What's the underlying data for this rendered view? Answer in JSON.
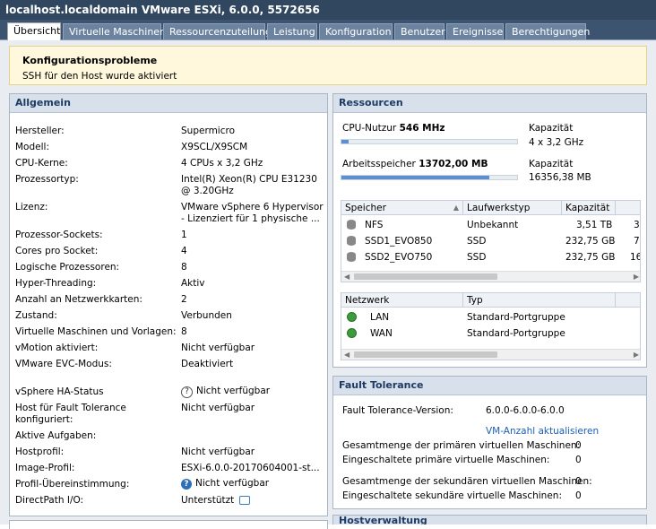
{
  "window": {
    "title": "localhost.localdomain VMware ESXi, 6.0.0, 5572656"
  },
  "tabs": [
    "Übersicht",
    "Virtuelle Maschinen",
    "Ressourcenzuteilung",
    "Leistung",
    "Konfiguration",
    "Benutzer",
    "Ereignisse",
    "Berechtigungen"
  ],
  "warning": {
    "title": "Konfigurationsprobleme",
    "message": "SSH für den Host wurde aktiviert"
  },
  "general": {
    "header": "Allgemein",
    "rows": [
      {
        "label": "Hersteller:",
        "value": "Supermicro"
      },
      {
        "label": "Modell:",
        "value": "X9SCL/X9SCM"
      },
      {
        "label": "CPU-Kerne:",
        "value": "4 CPUs x 3,2 GHz"
      },
      {
        "label": "Prozessortyp:",
        "value": "Intel(R) Xeon(R) CPU E31230",
        "value2": "@ 3.20GHz"
      },
      {
        "label": "Lizenz:",
        "value": "VMware vSphere 6 Hypervisor",
        "value2": "- Lizenziert für 1 physische ..."
      },
      {
        "label": "Prozessor-Sockets:",
        "value": "1"
      },
      {
        "label": "Cores pro Socket:",
        "value": "4"
      },
      {
        "label": "Logische Prozessoren:",
        "value": "8"
      },
      {
        "label": "Hyper-Threading:",
        "value": "Aktiv"
      },
      {
        "label": "Anzahl an Netzwerkkarten:",
        "value": "2"
      },
      {
        "label": "Zustand:",
        "value": "Verbunden"
      },
      {
        "label": "Virtuelle Maschinen und Vorlagen:",
        "value": "8"
      },
      {
        "label": "vMotion aktiviert:",
        "value": "Nicht verfügbar"
      },
      {
        "label": "VMware EVC-Modus:",
        "value": "Deaktiviert"
      },
      {
        "label": "vSphere HA-Status",
        "value": "Nicht verfügbar"
      },
      {
        "label": "Host für Fault Tolerance",
        "label2": "konfiguriert:",
        "value": "Nicht verfügbar"
      },
      {
        "label": "Aktive Aufgaben:",
        "value": ""
      },
      {
        "label": "Hostprofil:",
        "value": "Nicht verfügbar"
      },
      {
        "label": "Image-Profil:",
        "value": "ESXi-6.0.0-20170604001-st..."
      },
      {
        "label": "Profil-Übereinstimmung:",
        "value": "Nicht verfügbar"
      },
      {
        "label": "DirectPath I/O:",
        "value": "Unterstützt"
      }
    ]
  },
  "resources": {
    "header": "Ressourcen",
    "cpu": {
      "label": "CPU-Nutzur",
      "value": "546 MHz",
      "cap_label": "Kapazität",
      "cap_value": "4 x 3,2 GHz",
      "fill": 0.04
    },
    "mem": {
      "label": "Arbeitsspeicher",
      "value": "13702,00 MB",
      "cap_label": "Kapazität",
      "cap_value": "16356,38 MB",
      "fill": 0.84
    },
    "storage": {
      "headers": [
        "Speicher",
        "Laufwerkstyp",
        "Kapazität"
      ],
      "rows": [
        {
          "name": "NFS",
          "type": "Unbekannt",
          "cap": "3,51 TB",
          "extra": "3"
        },
        {
          "name": "SSD1_EVO850",
          "type": "SSD",
          "cap": "232,75 GB",
          "extra": "7"
        },
        {
          "name": "SSD2_EVO750",
          "type": "SSD",
          "cap": "232,75 GB",
          "extra": "16"
        }
      ]
    },
    "network": {
      "headers": [
        "Netzwerk",
        "Typ"
      ],
      "rows": [
        {
          "name": "LAN",
          "type": "Standard-Portgruppe"
        },
        {
          "name": "WAN",
          "type": "Standard-Portgruppe"
        }
      ]
    }
  },
  "fault_tolerance": {
    "header": "Fault Tolerance",
    "version_label": "Fault Tolerance-Version:",
    "version_value": "6.0.0-6.0.0-6.0.0",
    "refresh_link": "VM-Anzahl aktualisieren",
    "rows": [
      {
        "label": "Gesamtmenge der primären virtuellen Maschinen:",
        "value": "0"
      },
      {
        "label": "Eingeschaltete primäre virtuelle Maschinen:",
        "value": "0"
      },
      {
        "label": "Gesamtmenge der sekundären virtuellen Maschinen:",
        "value": "0"
      },
      {
        "label": "Eingeschaltete sekundäre virtuelle Maschinen:",
        "value": "0"
      }
    ]
  },
  "host_mgmt": {
    "header": "Hostverwaltung"
  },
  "colors": {
    "title_bg": "#31465f",
    "header_text": "#1e3b62",
    "warning_bg": "#fff8dc",
    "usage_bar": "#5b8fd0"
  }
}
